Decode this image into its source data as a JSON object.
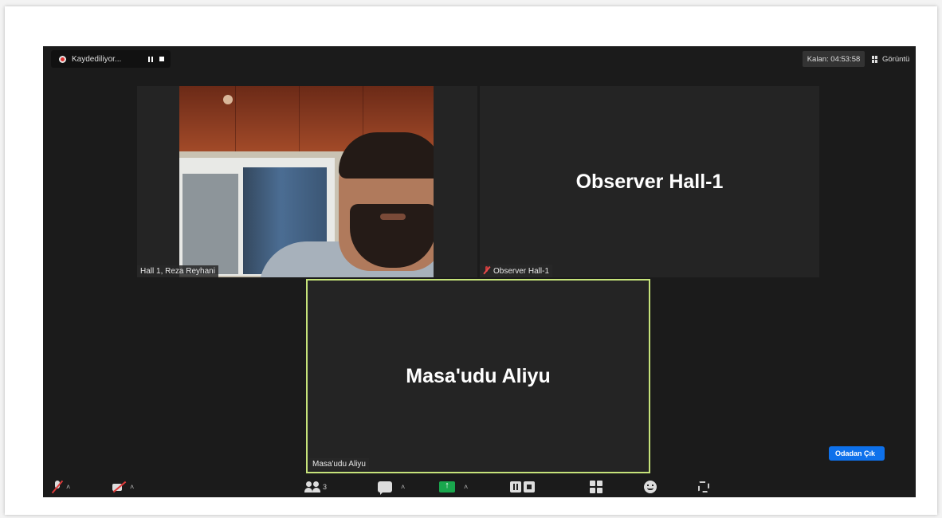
{
  "recording": {
    "label": "Kaydediliyor..."
  },
  "timer": {
    "label": "Kalan: 04:53:58"
  },
  "view": {
    "label": "Görüntü"
  },
  "participants": [
    {
      "label": "Hall 1, Reza Reyhani"
    },
    {
      "big_name": "Observer Hall-1",
      "label": "Observer Hall-1"
    },
    {
      "big_name": "Masa'udu Aliyu",
      "label": "Masa'udu Aliyu"
    }
  ],
  "toolbar": {
    "participant_count": "3",
    "leave_label": "Odadan Çık"
  },
  "colors": {
    "active_speaker_border": "#c6e37a",
    "share_green": "#19a74d",
    "leave_blue": "#0e71eb",
    "muted_red": "#e03a3a"
  },
  "icons": [
    "record-icon",
    "pause-icon",
    "stop-icon",
    "grid-view-icon",
    "mic-muted-icon",
    "camera-off-icon",
    "participants-icon",
    "chat-icon",
    "share-screen-icon",
    "record-control-icon",
    "apps-icon",
    "reactions-icon",
    "expand-icon"
  ]
}
